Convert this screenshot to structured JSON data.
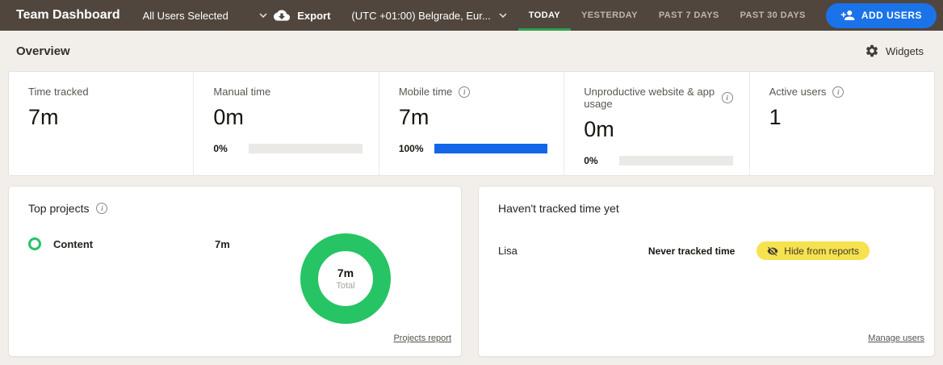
{
  "topbar": {
    "title": "Team Dashboard",
    "user_filter": "All Users Selected",
    "export_label": "Export",
    "timezone": "(UTC +01:00) Belgrade, Eur...",
    "tabs": [
      {
        "label": "TODAY",
        "active": true
      },
      {
        "label": "YESTERDAY",
        "active": false
      },
      {
        "label": "PAST 7 DAYS",
        "active": false
      },
      {
        "label": "PAST 30 DAYS",
        "active": false
      }
    ],
    "add_users_label": "ADD USERS"
  },
  "overview": {
    "title": "Overview",
    "widgets_label": "Widgets"
  },
  "stats": [
    {
      "label": "Time tracked",
      "value": "7m"
    },
    {
      "label": "Manual time",
      "value": "0m",
      "percent_label": "0%",
      "percent": 0
    },
    {
      "label": "Mobile time",
      "value": "7m",
      "percent_label": "100%",
      "percent": 100
    },
    {
      "label": "Unproductive website & app usage",
      "value": "0m",
      "percent_label": "0%",
      "percent": 0
    },
    {
      "label": "Active users",
      "value": "1"
    }
  ],
  "top_projects": {
    "title": "Top projects",
    "rows": [
      {
        "name": "Content",
        "duration": "7m"
      }
    ],
    "donut_center_value": "7m",
    "donut_center_label": "Total",
    "link_label": "Projects report",
    "chart_data": {
      "type": "pie",
      "categories": [
        "Content"
      ],
      "values": [
        7
      ],
      "unit": "minutes",
      "title": "Top projects",
      "center_text": "7m Total",
      "colors": [
        "#26c465"
      ],
      "legend_position": "left"
    }
  },
  "untracked": {
    "title": "Haven't tracked time yet",
    "rows": [
      {
        "name": "Lisa",
        "status": "Never tracked time",
        "action_label": "Hide from reports"
      }
    ],
    "link_label": "Manage users"
  },
  "colors": {
    "topbar_bg": "#50463e",
    "accent_blue": "#1a73e8",
    "progress_blue": "#1266e8",
    "donut_green": "#26c465",
    "tab_active_underline": "#2e9e4e",
    "badge_yellow": "#f6e24f",
    "page_bg": "#f2efeb"
  },
  "icons": {
    "export": "cloud-download",
    "user_filter": "chevron-down",
    "timezone": "chevron-down",
    "add_users": "person-add",
    "widgets": "gear",
    "stat_info": "info-circle",
    "project_bullet": "ring-circle",
    "hide_action": "eye-off"
  }
}
